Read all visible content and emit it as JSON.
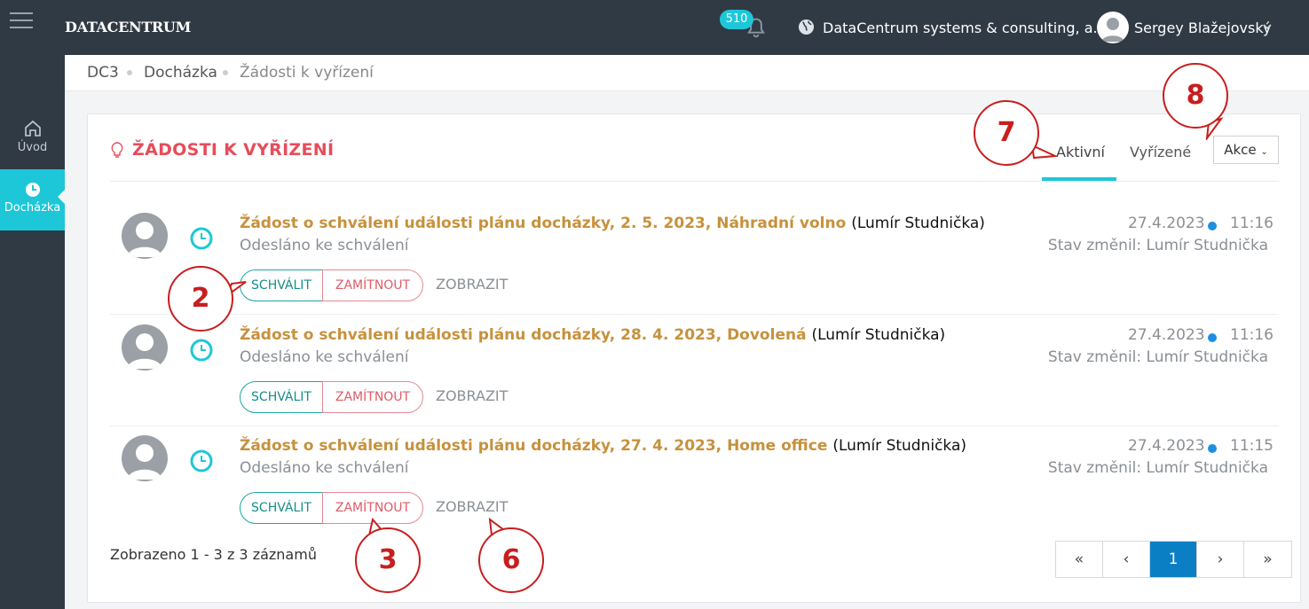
{
  "app": {
    "logo_text": "DataCentrum",
    "notifications_count": "510",
    "company": "DataCentrum systems & consulting, a.s.",
    "user": "Sergey Blažejovský"
  },
  "sidebar": {
    "items": [
      {
        "label": "Úvod",
        "icon": "home-icon"
      },
      {
        "label": "Docházka",
        "icon": "clock-icon",
        "active": true
      }
    ]
  },
  "breadcrumb": [
    "DC3",
    "Docházka",
    "Žádosti k vyřízení"
  ],
  "panel": {
    "title": "ŽÁDOSTI K VYŘÍZENÍ",
    "tabs": [
      {
        "label": "Aktivní",
        "active": true
      },
      {
        "label": "Vyřízené"
      }
    ],
    "actions_label": "Akce"
  },
  "requests": [
    {
      "title": "Žádost o schválení události plánu docházky, 2. 5. 2023, Náhradní volno",
      "person": "(Lumír Studnička)",
      "status": "Odesláno ke schválení",
      "date": "27.4.2023",
      "time": "11:16",
      "changed": "Stav změnil:  Lumír Studnička"
    },
    {
      "title": "Žádost o schválení události plánu docházky, 28. 4. 2023, Dovolená",
      "person": "(Lumír Studnička)",
      "status": "Odesláno ke schválení",
      "date": "27.4.2023",
      "time": "11:16",
      "changed": "Stav změnil:  Lumír Studnička"
    },
    {
      "title": "Žádost o schválení události plánu docházky, 27. 4. 2023, Home office",
      "person": "(Lumír Studnička)",
      "status": "Odesláno ke schválení",
      "date": "27.4.2023",
      "time": "11:15",
      "changed": "Stav změnil:  Lumír Studnička"
    }
  ],
  "buttons": {
    "approve": "SCHVÁLIT",
    "reject": "ZAMÍTNOUT",
    "view": "ZOBRAZIT"
  },
  "summary": "Zobrazeno 1 - 3 z 3 záznamů",
  "pagination": {
    "first": "«",
    "prev": "‹",
    "current": "1",
    "next": "›",
    "last": "»"
  },
  "annotations": [
    "2",
    "3",
    "6",
    "7",
    "8"
  ],
  "colors": {
    "accent": "#1ec7d8",
    "title_red": "#e74c5a",
    "link_gold": "#c7913c",
    "topbar": "#2f3a45",
    "page_active": "#0b7fc4",
    "callout_red": "#c81e1e"
  }
}
